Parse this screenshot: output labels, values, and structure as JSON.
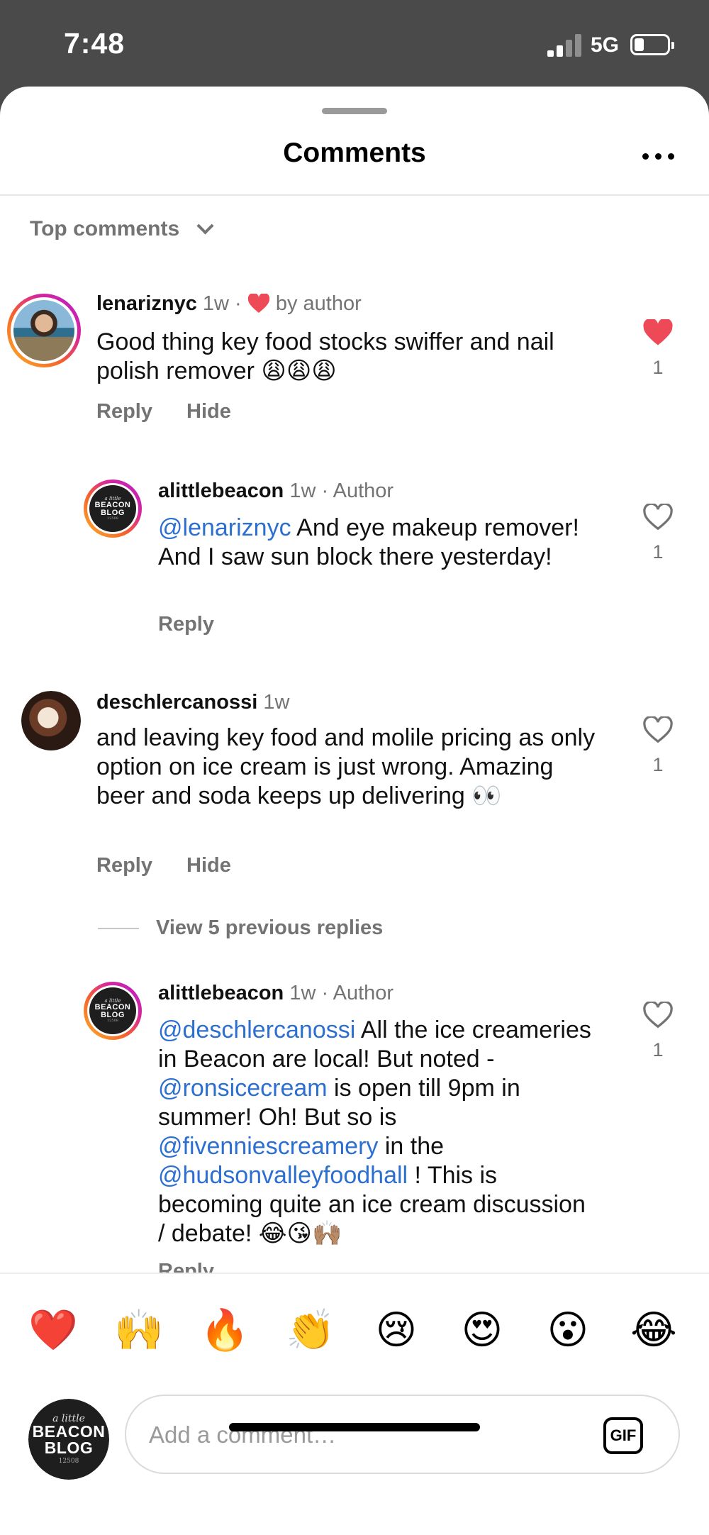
{
  "status_bar": {
    "time": "7:48",
    "network": "5G"
  },
  "header": {
    "title": "Comments"
  },
  "sort": {
    "label": "Top comments"
  },
  "comments": [
    {
      "user": "lenariznyc",
      "time": "1w",
      "meta_sep": "·",
      "badge": "by author",
      "segments": [
        {
          "t": "Good thing key food stocks swiffer and nail polish remover "
        },
        {
          "t": "😩😩😩",
          "emoji": true
        }
      ],
      "actions": [
        "Reply",
        "Hide"
      ],
      "likes": "1",
      "liked": true,
      "avatar": "profile-photo"
    },
    {
      "user": "alittlebeacon",
      "time": "1w",
      "meta_sep": "·",
      "badge": "Author",
      "segments": [
        {
          "t": "@lenariznyc",
          "mention": true
        },
        {
          "t": " And eye makeup remover! And I saw sun block there yesterday!"
        }
      ],
      "actions": [
        "Reply"
      ],
      "likes": "1",
      "liked": false,
      "avatar": "beacon-logo"
    },
    {
      "user": "deschlercanossi",
      "time": "1w",
      "segments": [
        {
          "t": "and leaving key food and molile pricing as only option on ice cream is just wrong. Amazing beer and soda keeps up delivering "
        },
        {
          "t": "👀",
          "emoji": true
        }
      ],
      "actions": [
        "Reply",
        "Hide"
      ],
      "likes": "1",
      "liked": false,
      "avatar": "profile-photo"
    },
    {
      "user": "alittlebeacon",
      "time": "1w",
      "meta_sep": "·",
      "badge": "Author",
      "segments": [
        {
          "t": "@deschlercanossi",
          "mention": true
        },
        {
          "t": " All the ice creameries in Beacon are local! But noted - "
        },
        {
          "t": "@ronsicecream",
          "mention": true
        },
        {
          "t": " is open till 9pm in summer! Oh! But so is "
        },
        {
          "t": "@fivenniescreamery",
          "mention": true
        },
        {
          "t": " in the "
        },
        {
          "t": "@hudsonvalleyfoodhall",
          "mention": true
        },
        {
          "t": " ! This is becoming quite an ice cream discussion / debate! "
        },
        {
          "t": "😂😘🙌🏽",
          "emoji": true
        }
      ],
      "actions": [
        "Reply"
      ],
      "likes": "1",
      "liked": false,
      "avatar": "beacon-logo"
    }
  ],
  "view_replies": "View 5 previous replies",
  "reactions": [
    "❤️",
    "🙌",
    "🔥",
    "👏",
    "😢",
    "😍",
    "😮",
    "😂"
  ],
  "compose": {
    "placeholder": "Add a comment…",
    "gif_label": "GIF"
  },
  "logo": {
    "small": "a little",
    "line1": "BEACON",
    "line2": "BLOG",
    "zip": "12508"
  },
  "colors": {
    "accent": "#2d6fd1",
    "like": "#ed4956",
    "secondary": "#737373"
  }
}
